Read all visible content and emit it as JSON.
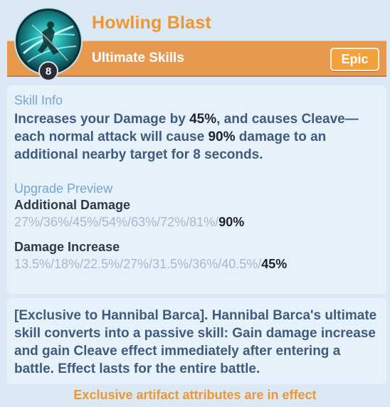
{
  "skill": {
    "name": "Howling Blast",
    "type": "Ultimate Skills",
    "rarity": "Epic",
    "level": "8",
    "icon": "howling-blast-skill-icon"
  },
  "skill_info": {
    "label": "Skill Info",
    "desc_1": "Increases your Damage by ",
    "desc_2": "45%",
    "desc_3": ", and causes Cleave—each normal attack will cause ",
    "desc_4": "90%",
    "desc_5": " damage to an additional nearby target for 8 seconds."
  },
  "upgrade_preview": {
    "label": "Upgrade Preview",
    "additional_damage": {
      "label": "Additional Damage",
      "values": "27%/36%/45%/54%/63%/72%/81%/",
      "current": "90%"
    },
    "damage_increase": {
      "label": "Damage Increase",
      "values": "13.5%/18%/22.5%/27%/31.5%/36%/40.5%/",
      "current": "45%"
    }
  },
  "exclusive_text": "[Exclusive to Hannibal Barca]. Hannibal Barca's ultimate skill converts into a passive skill: Gain damage increase and gain Cleave effect immediately after entering a battle. Effect lasts for the entire battle.",
  "footer": "Exclusive artifact attributes are in effect",
  "colors": {
    "accent_orange": "#f0962e",
    "banner": "#e79a4f",
    "text_blue": "#3f5c7c",
    "label_blue": "#76a7cf"
  }
}
